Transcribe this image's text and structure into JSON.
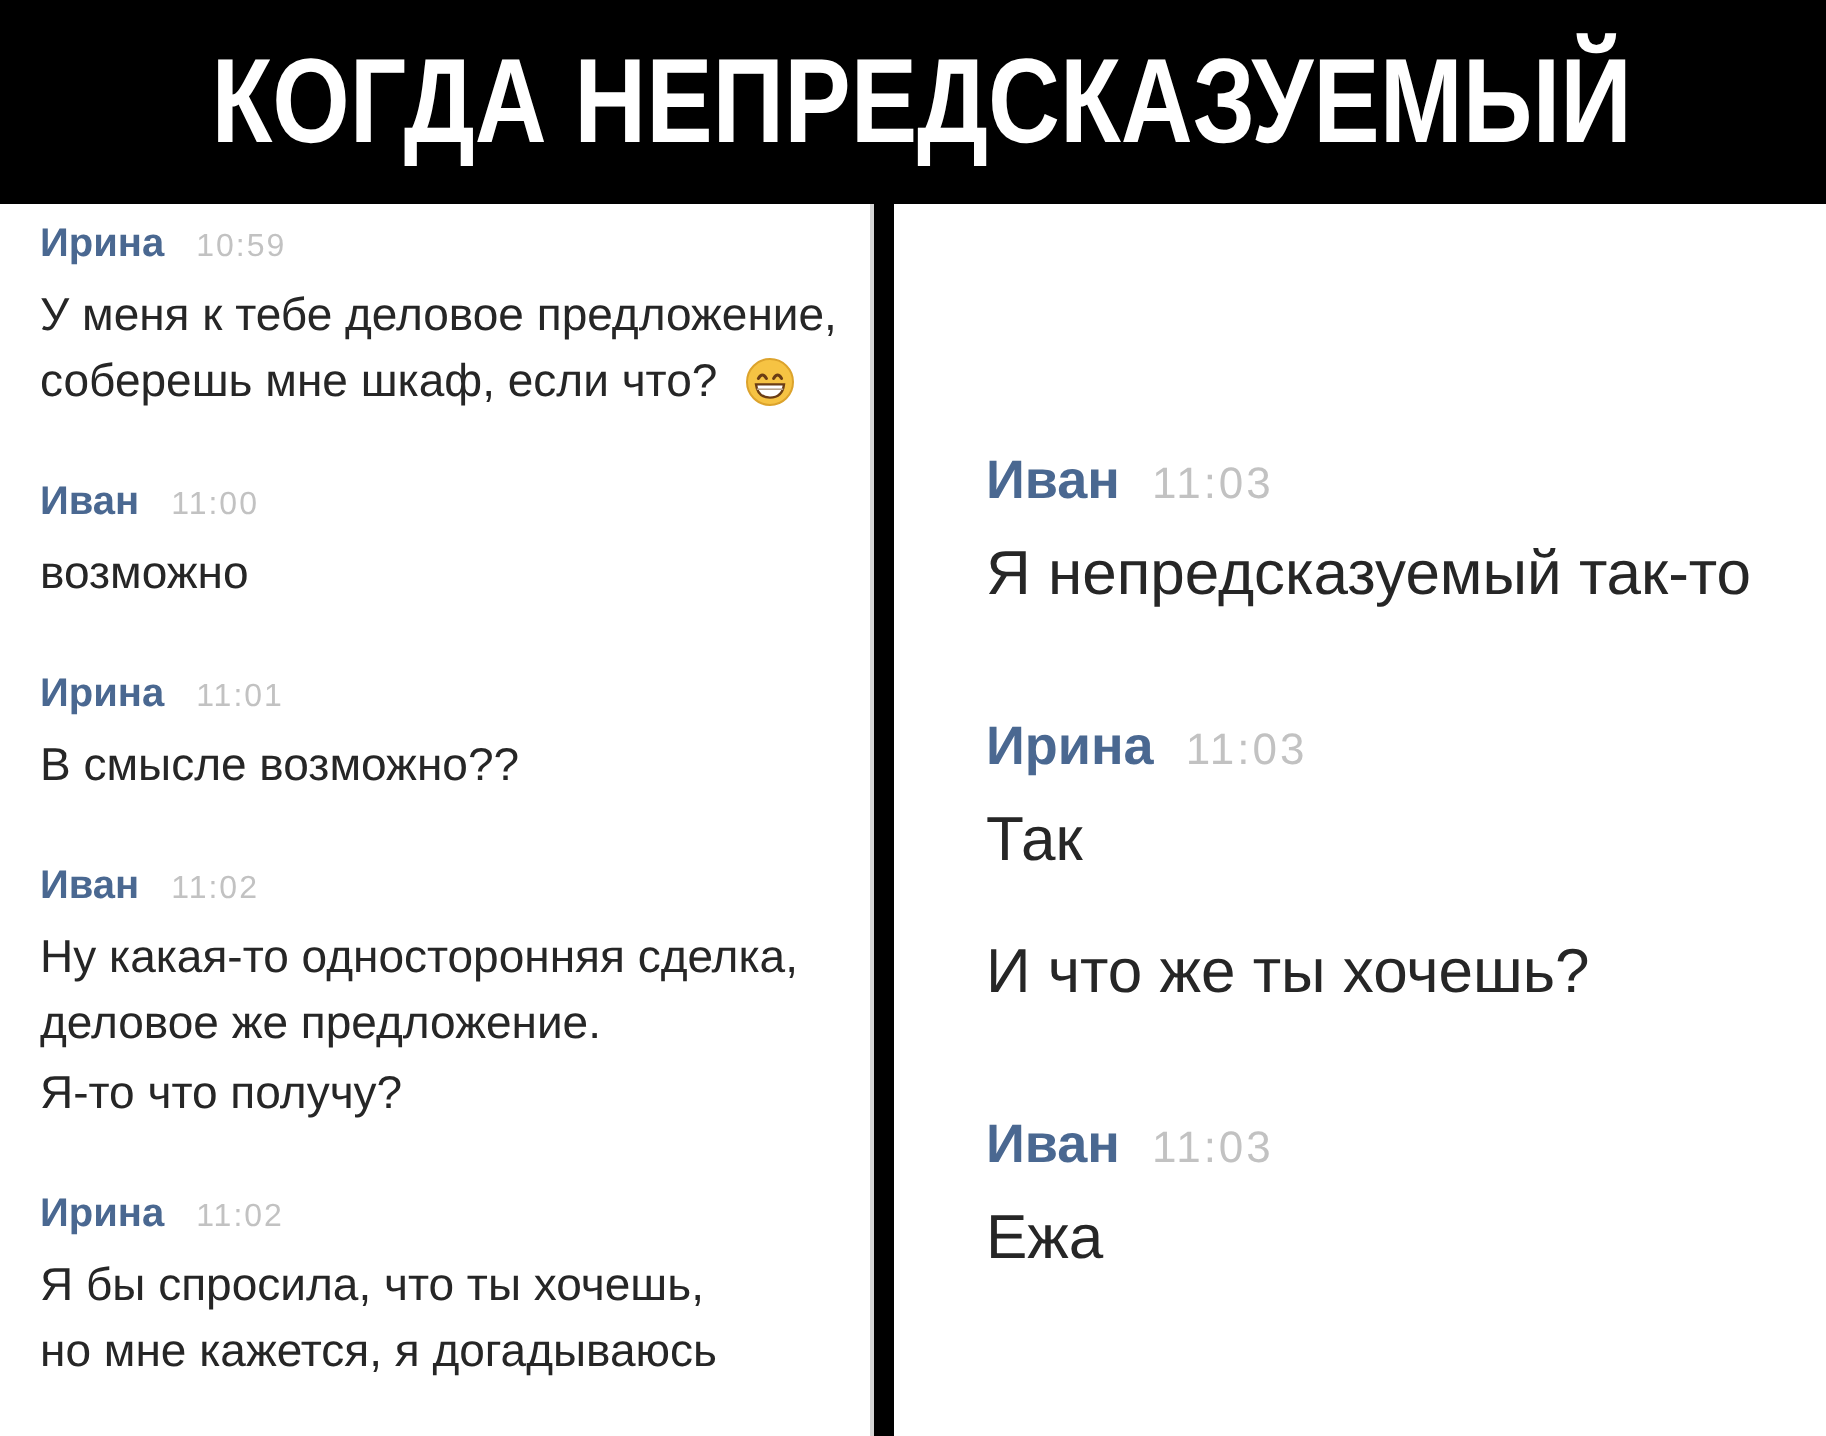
{
  "title": "КОГДА НЕПРЕДСКАЗУЕМЫЙ",
  "panels": [
    {
      "messages": [
        {
          "author": "Ирина",
          "time": "10:59",
          "texts": [
            "У меня к тебе деловое предложение,\nсоберешь мне шкаф, если что?"
          ],
          "emoji": true
        },
        {
          "author": "Иван",
          "time": "11:00",
          "texts": [
            "возможно"
          ],
          "emoji": false
        },
        {
          "author": "Ирина",
          "time": "11:01",
          "texts": [
            "В смысле возможно??"
          ],
          "emoji": false
        },
        {
          "author": "Иван",
          "time": "11:02",
          "texts": [
            "Ну какая-то односторонняя сделка,\nделовое же предложение.",
            "Я-то что получу?"
          ],
          "emoji": false
        },
        {
          "author": "Ирина",
          "time": "11:02",
          "texts": [
            "Я бы спросила, что ты хочешь,\nно мне кажется, я догадываюсь"
          ],
          "emoji": false
        }
      ]
    },
    {
      "messages": [
        {
          "author": "Иван",
          "time": "11:03",
          "texts": [
            "Я непредсказуемый так-то"
          ],
          "emoji": false
        },
        {
          "author": "Ирина",
          "time": "11:03",
          "texts": [
            "Так",
            "И что же ты хочешь?"
          ],
          "emoji": false
        },
        {
          "author": "Иван",
          "time": "11:03",
          "texts": [
            "Ежа"
          ],
          "emoji": false
        }
      ]
    }
  ]
}
